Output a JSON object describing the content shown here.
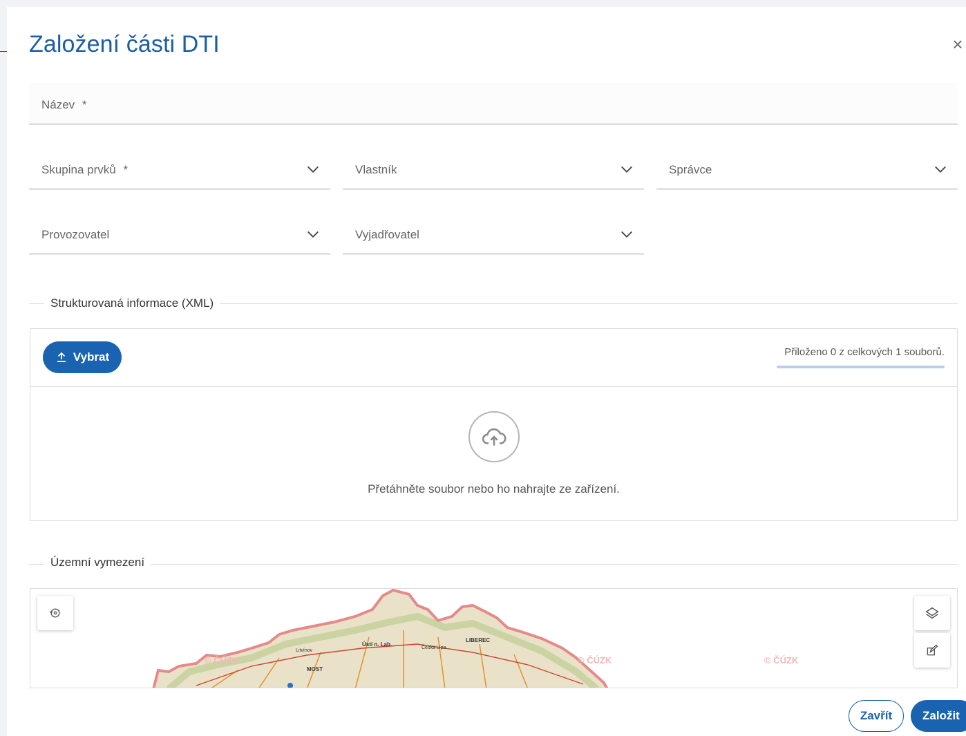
{
  "dialog": {
    "title": "Založení části DTI",
    "close_glyph": "×"
  },
  "form": {
    "nazev": {
      "label": "Název",
      "required_mark": "*"
    },
    "skupina_prvku": {
      "label": "Skupina prvků",
      "required_mark": "*"
    },
    "vlastnik": {
      "label": "Vlastník"
    },
    "spravce": {
      "label": "Správce"
    },
    "provozovatel": {
      "label": "Provozovatel"
    },
    "vyjadrovatel": {
      "label": "Vyjadřovatel"
    }
  },
  "xml_section": {
    "legend": "Strukturovaná informace (XML)",
    "select_button": "Vybrat",
    "progress_text": "Přiloženo 0 z celkových 1 souborů.",
    "progress_value": 0,
    "drop_text": "Přetáhněte soubor nebo ho nahrajte ze zařízení."
  },
  "map_section": {
    "legend": "Územní vymezení",
    "watermark": "© ČÚZK",
    "map_labels": [
      "Liberec",
      "Ústí n. Lab.",
      "Most",
      "Česká Lípa",
      "Litvínov"
    ],
    "controls": {
      "history_icon": "history-icon",
      "layers_icon": "layers-icon",
      "edit_icon": "edit-icon"
    }
  },
  "footer": {
    "close_button": "Zavřít",
    "create_button": "Založit"
  },
  "colors": {
    "primary": "#1a63b0",
    "title": "#1c5ea4"
  }
}
